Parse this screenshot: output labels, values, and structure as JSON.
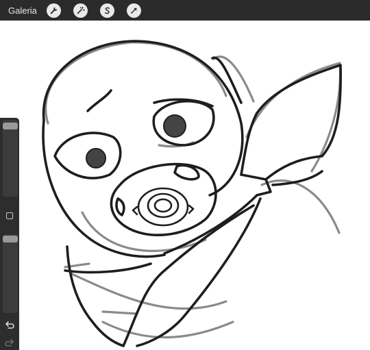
{
  "topbar": {
    "gallery_label": "Galeria",
    "tools": [
      {
        "name": "wrench-icon"
      },
      {
        "name": "magic-wand-icon"
      },
      {
        "name": "selection-s-icon"
      },
      {
        "name": "transform-arrow-icon"
      }
    ]
  },
  "sidebar": {
    "brush_size_level": 0.04,
    "opacity_level": 0.02
  },
  "colors": {
    "topbar": "#2b2b2b",
    "sidebar": "#2d2d2d",
    "canvas": "#ffffff",
    "stroke_dark": "#1e1e1e",
    "stroke_gray": "#8a8a8a"
  }
}
